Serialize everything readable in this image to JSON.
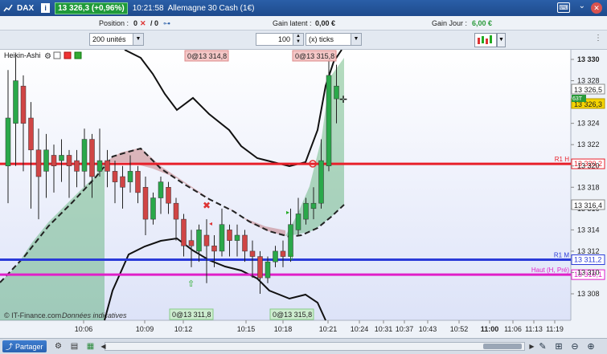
{
  "titlebar": {
    "instrument": "DAX",
    "info": "i",
    "quote": "13 326,3 (+0,96%)",
    "time": "10:21:58",
    "name": "Allemagne 30 Cash (1€)"
  },
  "position": {
    "label": "Position :",
    "value": "0",
    "close_glyph": "✕",
    "sep": "/ 0",
    "latent_label": "Gain latent :",
    "latent_value": "0,00 €",
    "day_label": "Gain Jour :",
    "day_value": "6,00 €"
  },
  "toolbar": {
    "units": "200 unités",
    "qty": "100",
    "ticks": "(x) ticks"
  },
  "chart": {
    "indicator": "Heikin-Ashi",
    "candles": [
      {
        "o": 13320.0,
        "c": 13324.5,
        "h": 13329.0,
        "l": 13316.5,
        "up": true
      },
      {
        "o": 13324.0,
        "c": 13328.0,
        "h": 13330.5,
        "l": 13320.0,
        "up": true
      },
      {
        "o": 13327.5,
        "c": 13324.0,
        "h": 13328.5,
        "l": 13319.5,
        "up": false
      },
      {
        "o": 13324.5,
        "c": 13321.5,
        "h": 13326.0,
        "l": 13316.0,
        "up": false
      },
      {
        "o": 13321.5,
        "c": 13319.0,
        "h": 13323.5,
        "l": 13315.0,
        "up": false
      },
      {
        "o": 13319.5,
        "c": 13321.5,
        "h": 13323.0,
        "l": 13317.0,
        "up": true
      },
      {
        "o": 13321.0,
        "c": 13320.0,
        "h": 13322.0,
        "l": 13317.5,
        "up": false
      },
      {
        "o": 13320.5,
        "c": 13321.0,
        "h": 13322.5,
        "l": 13318.5,
        "up": true
      },
      {
        "o": 13321.0,
        "c": 13320.0,
        "h": 13321.5,
        "l": 13317.0,
        "up": false
      },
      {
        "o": 13320.5,
        "c": 13319.5,
        "h": 13321.5,
        "l": 13318.0,
        "up": false
      },
      {
        "o": 13319.5,
        "c": 13322.5,
        "h": 13323.5,
        "l": 13318.0,
        "up": true
      },
      {
        "o": 13322.5,
        "c": 13319.0,
        "h": 13323.0,
        "l": 13317.0,
        "up": false
      },
      {
        "o": 13319.5,
        "c": 13320.5,
        "h": 13323.5,
        "l": 13319.0,
        "up": true
      },
      {
        "o": 13320.5,
        "c": 13319.5,
        "h": 13321.5,
        "l": 13318.0,
        "up": false
      },
      {
        "o": 13319.5,
        "c": 13318.5,
        "h": 13320.5,
        "l": 13316.5,
        "up": false
      },
      {
        "o": 13319.0,
        "c": 13318.0,
        "h": 13320.0,
        "l": 13316.0,
        "up": false
      },
      {
        "o": 13318.5,
        "c": 13319.5,
        "h": 13321.0,
        "l": 13317.5,
        "up": true
      },
      {
        "o": 13319.5,
        "c": 13317.5,
        "h": 13320.0,
        "l": 13316.5,
        "up": false
      },
      {
        "o": 13318.0,
        "c": 13315.0,
        "h": 13319.0,
        "l": 13313.5,
        "up": false
      },
      {
        "o": 13315.0,
        "c": 13317.0,
        "h": 13317.5,
        "l": 13314.5,
        "up": true
      },
      {
        "o": 13317.0,
        "c": 13318.5,
        "h": 13319.0,
        "l": 13315.5,
        "up": true
      },
      {
        "o": 13318.0,
        "c": 13316.5,
        "h": 13318.5,
        "l": 13315.5,
        "up": false
      },
      {
        "o": 13316.5,
        "c": 13315.0,
        "h": 13317.0,
        "l": 13313.0,
        "up": false
      },
      {
        "o": 13315.0,
        "c": 13312.5,
        "h": 13315.5,
        "l": 13311.5,
        "up": false
      },
      {
        "o": 13313.0,
        "c": 13312.5,
        "h": 13314.0,
        "l": 13310.5,
        "up": false
      },
      {
        "o": 13312.0,
        "c": 13314.0,
        "h": 13314.5,
        "l": 13311.0,
        "up": true
      },
      {
        "o": 13313.5,
        "c": 13312.5,
        "h": 13315.0,
        "l": 13309.0,
        "up": false
      },
      {
        "o": 13312.5,
        "c": 13312.0,
        "h": 13313.5,
        "l": 13310.5,
        "up": false
      },
      {
        "o": 13312.0,
        "c": 13314.5,
        "h": 13316.0,
        "l": 13311.5,
        "up": true
      },
      {
        "o": 13314.0,
        "c": 13313.0,
        "h": 13314.5,
        "l": 13311.5,
        "up": false
      },
      {
        "o": 13313.0,
        "c": 13313.5,
        "h": 13314.5,
        "l": 13311.5,
        "up": true
      },
      {
        "o": 13313.5,
        "c": 13312.0,
        "h": 13314.0,
        "l": 13311.0,
        "up": false
      },
      {
        "o": 13312.0,
        "c": 13311.5,
        "h": 13313.0,
        "l": 13309.5,
        "up": false
      },
      {
        "o": 13311.5,
        "c": 13309.5,
        "h": 13312.0,
        "l": 13308.0,
        "up": false
      },
      {
        "o": 13309.5,
        "c": 13311.0,
        "h": 13311.5,
        "l": 13309.0,
        "up": true
      },
      {
        "o": 13311.0,
        "c": 13312.0,
        "h": 13312.5,
        "l": 13310.5,
        "up": true
      },
      {
        "o": 13312.0,
        "c": 13311.5,
        "h": 13313.0,
        "l": 13310.5,
        "up": false
      },
      {
        "o": 13311.5,
        "c": 13314.5,
        "h": 13316.0,
        "l": 13311.0,
        "up": true
      },
      {
        "o": 13314.0,
        "c": 13315.5,
        "h": 13317.0,
        "l": 13313.5,
        "up": true
      },
      {
        "o": 13315.0,
        "c": 13316.5,
        "h": 13317.0,
        "l": 13314.5,
        "up": true
      },
      {
        "o": 13316.0,
        "c": 13316.5,
        "h": 13318.0,
        "l": 13315.0,
        "up": true
      },
      {
        "o": 13316.5,
        "c": 13320.5,
        "h": 13322.5,
        "l": 13316.0,
        "up": true
      },
      {
        "o": 13320.0,
        "c": 13328.5,
        "h": 13330.0,
        "l": 13319.5,
        "up": true
      },
      {
        "o": 13327.5,
        "c": 13326.3,
        "h": 13329.5,
        "l": 13324.0,
        "up": true
      }
    ],
    "y_ticks": [
      "13 330",
      "13 328",
      "13 326",
      "13 324",
      "13 322",
      "13 320",
      "13 318",
      "13 316",
      "13 314",
      "13 312",
      "13 310",
      "13 308"
    ],
    "x_ticks": [
      "10:06",
      "10:09",
      "10:12",
      "10:15",
      "10:18",
      "10:21",
      "10:24",
      "10:31",
      "10:37",
      "10:43",
      "10:52",
      "11:00",
      "11:06",
      "11:13",
      "11:19"
    ],
    "current_price": "13 326,3",
    "current_price_alt": "13 326,5",
    "levels": [
      {
        "name": "R1 H",
        "value": 13320.2,
        "label": "13 320,2",
        "color": "#e8202a"
      },
      {
        "name": "R1 M",
        "value": 13311.2,
        "label": "13 311,2",
        "color": "#2a3ad8"
      },
      {
        "name": "Haut (H, Pré)",
        "value": 13310.1,
        "label": "13 310,1",
        "color": "#e020c8"
      }
    ],
    "level_316": "13 316,4",
    "orders_top": [
      "0@13 314,8",
      "0@13 315,8"
    ],
    "orders_bottom": [
      "0@13 311,8",
      "0@13 315,8"
    ],
    "tick_counter": "63T",
    "copyright": "© IT-Finance.com",
    "note": "Données indicatives"
  },
  "statusbar": {
    "share": "Partager",
    "clock": "11:00"
  }
}
